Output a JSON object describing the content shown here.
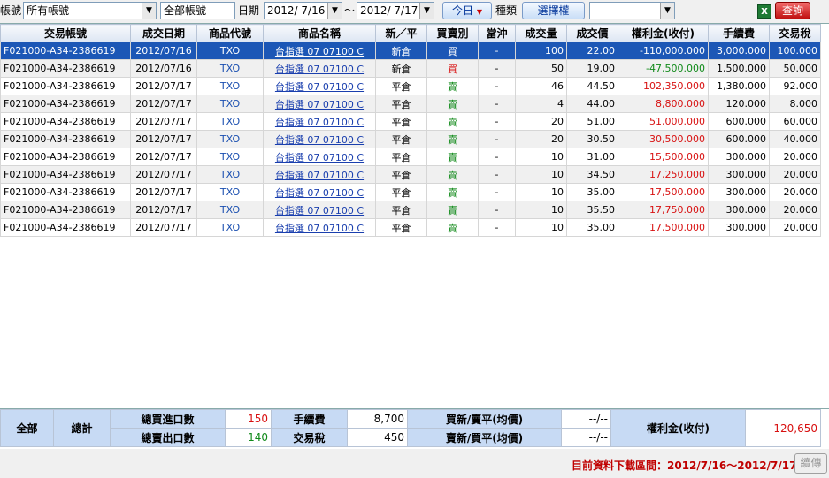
{
  "toolbar": {
    "account_label": "帳號",
    "account_select": "所有帳號",
    "account_input": "全部帳號",
    "date_label": "日期",
    "date_from": "2012/ 7/16",
    "tilde": "～",
    "date_to": "2012/ 7/17",
    "today_button": "今日",
    "type_label": "種類",
    "option_button": "選擇權",
    "type_select": "--",
    "excel_icon": "excel-icon",
    "query_button": "查詢"
  },
  "columns": [
    "交易帳號",
    "成交日期",
    "商品代號",
    "商品名稱",
    "新／平",
    "買賣別",
    "當沖",
    "成交量",
    "成交價",
    "權利金(收付)",
    "手續費",
    "交易稅"
  ],
  "rows": [
    {
      "account": "F021000-A34-2386619",
      "date": "2012/07/16",
      "code": "TXO",
      "name": "台指選 07 07100 C",
      "open_close": "新倉",
      "side": "買",
      "daytrade": "-",
      "qty": "100",
      "price": "22.00",
      "premium": "-110,000.000",
      "fee": "3,000.000",
      "tax": "100.000"
    },
    {
      "account": "F021000-A34-2386619",
      "date": "2012/07/16",
      "code": "TXO",
      "name": "台指選 07 07100 C",
      "open_close": "新倉",
      "side": "買",
      "daytrade": "-",
      "qty": "50",
      "price": "19.00",
      "premium": "-47,500.000",
      "fee": "1,500.000",
      "tax": "50.000"
    },
    {
      "account": "F021000-A34-2386619",
      "date": "2012/07/17",
      "code": "TXO",
      "name": "台指選 07 07100 C",
      "open_close": "平倉",
      "side": "賣",
      "daytrade": "-",
      "qty": "46",
      "price": "44.50",
      "premium": "102,350.000",
      "fee": "1,380.000",
      "tax": "92.000"
    },
    {
      "account": "F021000-A34-2386619",
      "date": "2012/07/17",
      "code": "TXO",
      "name": "台指選 07 07100 C",
      "open_close": "平倉",
      "side": "賣",
      "daytrade": "-",
      "qty": "4",
      "price": "44.00",
      "premium": "8,800.000",
      "fee": "120.000",
      "tax": "8.000"
    },
    {
      "account": "F021000-A34-2386619",
      "date": "2012/07/17",
      "code": "TXO",
      "name": "台指選 07 07100 C",
      "open_close": "平倉",
      "side": "賣",
      "daytrade": "-",
      "qty": "20",
      "price": "51.00",
      "premium": "51,000.000",
      "fee": "600.000",
      "tax": "60.000"
    },
    {
      "account": "F021000-A34-2386619",
      "date": "2012/07/17",
      "code": "TXO",
      "name": "台指選 07 07100 C",
      "open_close": "平倉",
      "side": "賣",
      "daytrade": "-",
      "qty": "20",
      "price": "30.50",
      "premium": "30,500.000",
      "fee": "600.000",
      "tax": "40.000"
    },
    {
      "account": "F021000-A34-2386619",
      "date": "2012/07/17",
      "code": "TXO",
      "name": "台指選 07 07100 C",
      "open_close": "平倉",
      "side": "賣",
      "daytrade": "-",
      "qty": "10",
      "price": "31.00",
      "premium": "15,500.000",
      "fee": "300.000",
      "tax": "20.000"
    },
    {
      "account": "F021000-A34-2386619",
      "date": "2012/07/17",
      "code": "TXO",
      "name": "台指選 07 07100 C",
      "open_close": "平倉",
      "side": "賣",
      "daytrade": "-",
      "qty": "10",
      "price": "34.50",
      "premium": "17,250.000",
      "fee": "300.000",
      "tax": "20.000"
    },
    {
      "account": "F021000-A34-2386619",
      "date": "2012/07/17",
      "code": "TXO",
      "name": "台指選 07 07100 C",
      "open_close": "平倉",
      "side": "賣",
      "daytrade": "-",
      "qty": "10",
      "price": "35.00",
      "premium": "17,500.000",
      "fee": "300.000",
      "tax": "20.000"
    },
    {
      "account": "F021000-A34-2386619",
      "date": "2012/07/17",
      "code": "TXO",
      "name": "台指選 07 07100 C",
      "open_close": "平倉",
      "side": "賣",
      "daytrade": "-",
      "qty": "10",
      "price": "35.50",
      "premium": "17,750.000",
      "fee": "300.000",
      "tax": "20.000"
    },
    {
      "account": "F021000-A34-2386619",
      "date": "2012/07/17",
      "code": "TXO",
      "name": "台指選 07 07100 C",
      "open_close": "平倉",
      "side": "賣",
      "daytrade": "-",
      "qty": "10",
      "price": "35.00",
      "premium": "17,500.000",
      "fee": "300.000",
      "tax": "20.000"
    }
  ],
  "selected_row": 0,
  "summary": {
    "all": "全部",
    "total": "總計",
    "buy_open_label": "總買進口數",
    "buy_open_value": "150",
    "sell_open_label": "總賣出口數",
    "sell_open_value": "140",
    "fee_label": "手續費",
    "fee_value": "8,700",
    "tax_label": "交易稅",
    "tax_value": "450",
    "buy_new_label": "買新/賣平(均價)",
    "buy_new_value": "--/--",
    "sell_new_label": "賣新/買平(均價)",
    "sell_new_value": "--/--",
    "premium_label": "權利金(收付)",
    "premium_value": "120,650"
  },
  "footer": {
    "range_text": "目前資料下載區間：2012/7/16～2012/7/17",
    "continue_button": "續傳"
  },
  "colors": {
    "selected_row": "#1c57b6",
    "buy": "#d81010",
    "sell": "#118a1a",
    "header_bg": "#c7daf4"
  }
}
